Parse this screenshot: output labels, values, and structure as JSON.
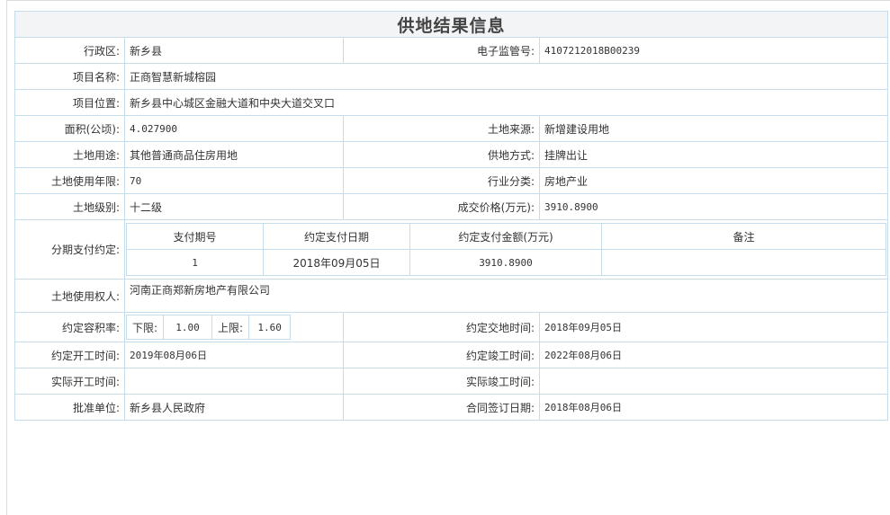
{
  "title": "供地结果信息",
  "fields": {
    "district_label": "行政区:",
    "district_value": "新乡县",
    "supervision_no_label": "电子监管号:",
    "supervision_no_value": "4107212018B00239",
    "project_name_label": "项目名称:",
    "project_name_value": "正商智慧新城榕园",
    "project_location_label": "项目位置:",
    "project_location_value": "新乡县中心城区金融大道和中央大道交叉口",
    "area_label": "面积(公顷):",
    "area_value": "4.027900",
    "land_source_label": "土地来源:",
    "land_source_value": "新增建设用地",
    "land_use_label": "土地用途:",
    "land_use_value": "其他普通商品住房用地",
    "supply_method_label": "供地方式:",
    "supply_method_value": "挂牌出让",
    "use_years_label": "土地使用年限:",
    "use_years_value": "70",
    "industry_label": "行业分类:",
    "industry_value": "房地产业",
    "land_level_label": "土地级别:",
    "land_level_value": "十二级",
    "price_label": "成交价格(万元):",
    "price_value": "3910.8900",
    "installment_label": "分期支付约定:",
    "land_user_label": "土地使用权人:",
    "land_user_value": "河南正商郑新房地产有限公司",
    "far_label": "约定容积率:",
    "delivery_time_label": "约定交地时间:",
    "delivery_time_value": "2018年09月05日",
    "start_time_label": "约定开工时间:",
    "start_time_value": "2019年08月06日",
    "completion_time_label": "约定竣工时间:",
    "completion_time_value": "2022年08月06日",
    "actual_start_label": "实际开工时间:",
    "actual_start_value": "",
    "actual_completion_label": "实际竣工时间:",
    "actual_completion_value": "",
    "approval_unit_label": "批准单位:",
    "approval_unit_value": "新乡县人民政府",
    "contract_date_label": "合同签订日期:",
    "contract_date_value": "2018年08月06日"
  },
  "installment_table": {
    "headers": [
      "支付期号",
      "约定支付日期",
      "约定支付金额(万元)",
      "备注"
    ],
    "rows": [
      [
        "1",
        "2018年09月05日",
        "3910.8900",
        ""
      ]
    ]
  },
  "far": {
    "lower_label": "下限:",
    "lower_value": "1.00",
    "upper_label": "上限:",
    "upper_value": "1.60"
  }
}
